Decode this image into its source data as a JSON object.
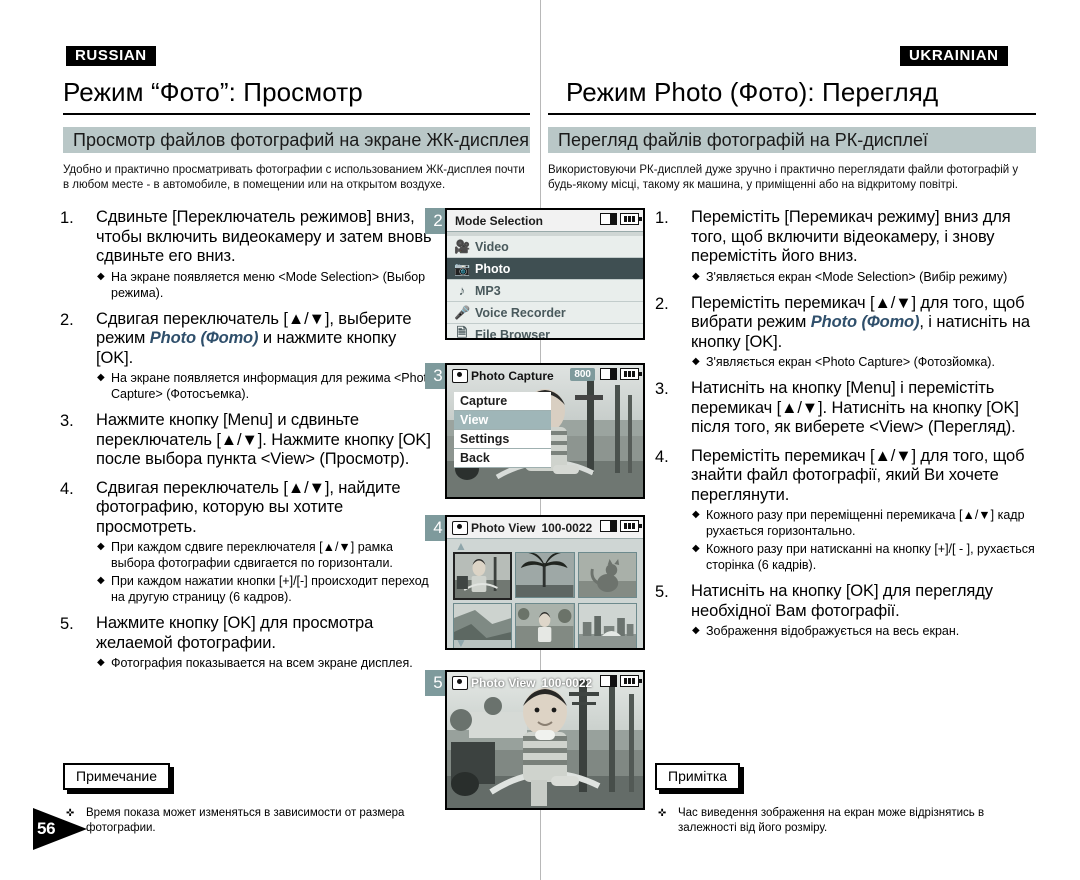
{
  "colors": {
    "banner": "#b9c7c7",
    "step_badge": "#7e9a9c",
    "accent_italic": "#2f4f6b"
  },
  "page_number": "56",
  "left": {
    "language_tag": "RUSSIAN",
    "chapter_title": "Режим “Фото”: Просмотр",
    "section_banner": "Просмотр файлов фотографий на экране ЖК-дисплея",
    "intro": "Удобно и практично просматривать фотографии с использованием ЖК-дисплея почти в любом месте - в автомобиле, в помещении или на открытом воздухе.",
    "steps": [
      {
        "num": "1.",
        "text_pre": "Сдвиньте [Переключатель режимов] вниз, чтобы включить видеокамеру и затем вновь сдвиньте его вниз.",
        "text_em": "",
        "text_post": "",
        "bullets": [
          "На экране появляется меню <Mode Selection> (Выбор режима)."
        ]
      },
      {
        "num": "2.",
        "text_pre": "Сдвигая переключатель [▲/▼], выберите режим ",
        "text_em": "Photo (Фото)",
        "text_post": " и нажмите кнопку [OK].",
        "bullets": [
          "На экране появляется информация для режима <Photo Capture> (Фотосъемка)."
        ]
      },
      {
        "num": "3.",
        "text_pre": "Нажмите кнопку [Menu] и сдвиньте переключатель [▲/▼]. Нажмите кнопку [OK] после выбора пункта <View> (Просмотр).",
        "text_em": "",
        "text_post": "",
        "bullets": []
      },
      {
        "num": "4.",
        "text_pre": "Сдвигая переключатель [▲/▼], найдите фотографию, которую вы хотите просмотреть.",
        "text_em": "",
        "text_post": "",
        "bullets": [
          "При каждом сдвиге переключателя [▲/▼] рамка выбора фотографии сдвигается по горизонтали.",
          "При каждом нажатии кнопки [+]/[-] происходит переход на другую страницу (6 кадров)."
        ]
      },
      {
        "num": "5.",
        "text_pre": "Нажмите кнопку [OK] для просмотра желаемой фотографии.",
        "text_em": "",
        "text_post": "",
        "bullets": [
          "Фотография показывается на всем экране дисплея."
        ]
      }
    ],
    "note_label": "Примечание",
    "note_text": "Время показа может изменяться в зависимости от размера фотографии."
  },
  "right": {
    "language_tag": "UKRAINIAN",
    "chapter_title": "Режим Photo (Фото): Перегляд",
    "section_banner": "Перегляд файлів фотографій на РК-дисплеї",
    "intro": "Використовуючи РК-дисплей дуже зручно і практично переглядати файли фотографій у будь-якому місці, такому як машина, у приміщенні або на відкритому повітрі.",
    "steps": [
      {
        "num": "1.",
        "text_pre": "Перемістіть [Перемикач режиму] вниз для того, щоб включити відеокамеру, і знову перемістіть його вниз.",
        "text_em": "",
        "text_post": "",
        "bullets": [
          "З'являється екран <Mode Selection> (Вибір режиму)"
        ]
      },
      {
        "num": "2.",
        "text_pre": "Перемістіть перемикач [▲/▼] для того, щоб вибрати режим ",
        "text_em": "Photo (Фото)",
        "text_post": ", і натисніть на кнопку [OK].",
        "bullets": [
          "З'являється екран <Photo Capture> (Фотозйомка)."
        ]
      },
      {
        "num": "3.",
        "text_pre": "Натисніть на кнопку [Menu] і перемістіть перемикач [▲/▼]. Натисніть на кнопку [OK] після того, як виберете <View> (Перегляд).",
        "text_em": "",
        "text_post": "",
        "bullets": []
      },
      {
        "num": "4.",
        "text_pre": "Перемістіть перемикач [▲/▼] для того, щоб знайти файл фотографії, який Ви хочете переглянути.",
        "text_em": "",
        "text_post": "",
        "bullets": [
          "Кожного разу при переміщенні перемикача [▲/▼] кадр рухається горизонтально.",
          "Кожного разу при натисканні на кнопку [+]/[ - ], рухається сторінка (6 кадрів)."
        ]
      },
      {
        "num": "5.",
        "text_pre": "Натисніть на кнопку [OK] для перегляду необхідної Вам фотографії.",
        "text_em": "",
        "text_post": "",
        "bullets": [
          "Зображення відображується на весь екран."
        ]
      }
    ],
    "note_label": "Примітка",
    "note_text": "Час виведення зображення на екран може відрізнятись в залежності від його розміру."
  },
  "screens": [
    {
      "step": "2",
      "title": "Mode Selection",
      "icons": [
        "sd-card-icon",
        "battery-icon"
      ],
      "menu": [
        {
          "label": "Video",
          "icon": "camcorder-icon",
          "selected": false
        },
        {
          "label": "Photo",
          "icon": "camera-icon",
          "selected": true
        },
        {
          "label": "MP3",
          "icon": "music-note-icon",
          "selected": false
        },
        {
          "label": "Voice Recorder",
          "icon": "microphone-icon",
          "selected": false
        },
        {
          "label": "File Browser",
          "icon": "file-icon",
          "selected": false
        }
      ],
      "scroll_more": "▼"
    },
    {
      "step": "3",
      "title": "Photo Capture",
      "counter": "800",
      "menu": [
        {
          "label": "Capture",
          "selected": false
        },
        {
          "label": "View",
          "selected": true
        },
        {
          "label": "Settings",
          "selected": false
        },
        {
          "label": "Back",
          "selected": false
        }
      ]
    },
    {
      "step": "4",
      "title": "Photo View",
      "file_id": "100-0022",
      "thumbnails": [
        {
          "alt": "boy-on-tricycle",
          "selected": true
        },
        {
          "alt": "palm-tree",
          "selected": false
        },
        {
          "alt": "cat",
          "selected": false
        },
        {
          "alt": "coastline",
          "selected": false
        },
        {
          "alt": "boy-in-garden",
          "selected": false
        },
        {
          "alt": "city-skyline",
          "selected": false
        }
      ]
    },
    {
      "step": "5",
      "title": "Photo View",
      "file_id": "100-0022",
      "photo_alt": "boy-on-tricycle-fullscreen"
    }
  ]
}
